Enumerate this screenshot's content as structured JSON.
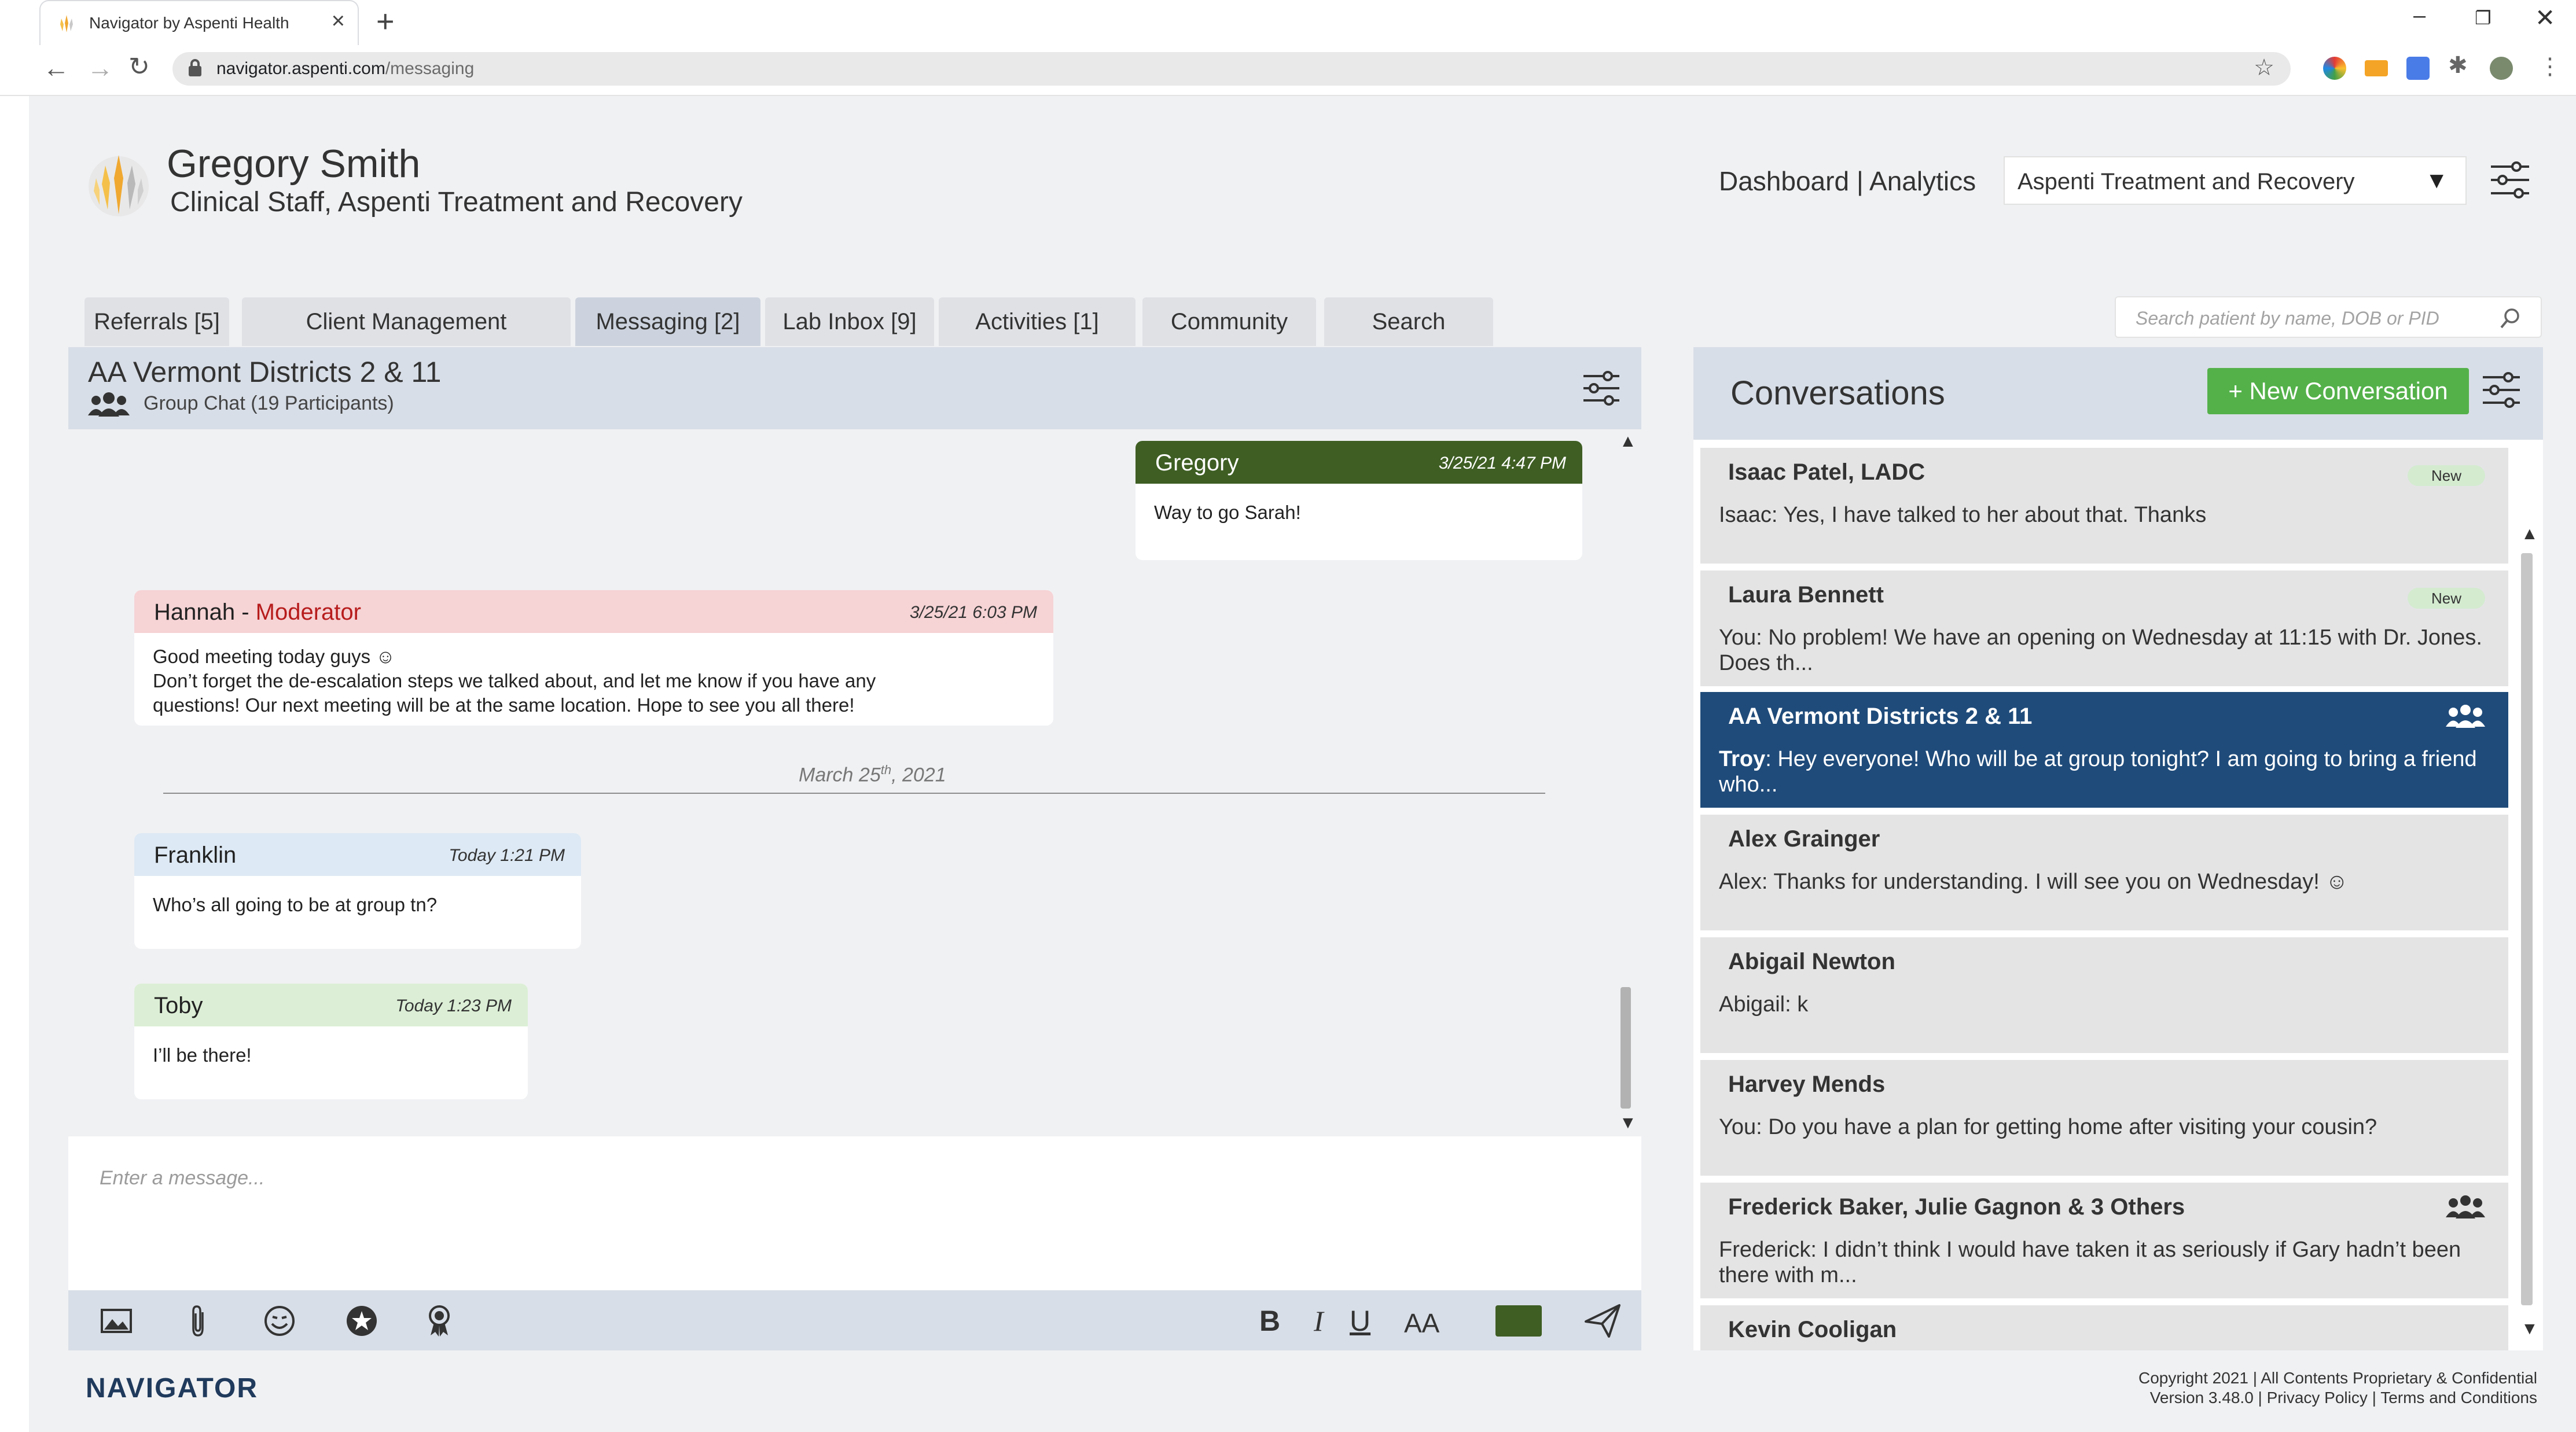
{
  "browser": {
    "tab_title": "Navigator by Aspenti Health",
    "url_host": "navigator.aspenti.com",
    "url_path": "/messaging"
  },
  "header": {
    "user_name": "Gregory Smith",
    "user_role": "Clinical Staff, Aspenti Treatment and Recovery",
    "dashboard_link": "Dashboard | Analytics",
    "org_selected": "Aspenti Treatment and Recovery"
  },
  "tabs": [
    {
      "label": "Referrals [5]"
    },
    {
      "label": "Client Management"
    },
    {
      "label": "Messaging [2]"
    },
    {
      "label": "Lab Inbox [9]"
    },
    {
      "label": "Activities [1]"
    },
    {
      "label": "Community"
    },
    {
      "label": "Search"
    }
  ],
  "search": {
    "placeholder": "Search patient by name, DOB or PID"
  },
  "chat": {
    "title": "AA Vermont Districts 2 & 11",
    "subtitle": "Group Chat (19 Participants)",
    "messages": [
      {
        "sender": "Gregory",
        "time": "3/25/21  4:47 PM",
        "text": "Way to go Sarah!"
      },
      {
        "sender": "Hannah",
        "role_sep": " - ",
        "role": "Moderator",
        "time": "3/25/21   6:03 PM",
        "lines": [
          "Good meeting today guys ☺",
          "Don’t forget the de-escalation steps we talked about, and let me know if you have any",
          "questions! Our next meeting will be at the same location. Hope to see you all there!"
        ]
      },
      {
        "sender": "Franklin",
        "time": "Today 1:21 PM",
        "text": "Who’s all going to be at group tn?"
      },
      {
        "sender": "Toby",
        "time": "Today 1:23 PM",
        "text": "I’ll be there!"
      }
    ],
    "date_divider": {
      "main": "March 25",
      "sup": "th",
      "year": ", 2021"
    },
    "composer_placeholder": "Enter a message...",
    "format": {
      "bold": "B",
      "italic": "I",
      "underline": "U",
      "size": "AA"
    }
  },
  "conversations": {
    "title": "Conversations",
    "new_button": "+ New Conversation",
    "items": [
      {
        "name": "Isaac Patel, LADC",
        "preview": "Isaac: Yes, I have talked to her about that. Thanks",
        "badge": "New"
      },
      {
        "name": "Laura Bennett",
        "preview": "You: No problem! We have an opening on Wednesday at 11:15 with Dr. Jones. Does th...",
        "badge": "New"
      },
      {
        "name": "AA Vermont Districts 2 & 11",
        "preview_who": "Troy",
        "preview_rest": ": Hey everyone! Who will be at group tonight? I am going to bring a friend who...",
        "group": true
      },
      {
        "name": "Alex Grainger",
        "preview": "Alex: Thanks for understanding. I will see you on Wednesday! ☺"
      },
      {
        "name": "Abigail Newton",
        "preview": "Abigail: k"
      },
      {
        "name": "Harvey Mends",
        "preview": "You: Do you have a plan for getting home after visiting your cousin?"
      },
      {
        "name": "Frederick Baker, Julie Gagnon & 3 Others",
        "preview": "Frederick: I didn’t think I would have taken it as seriously if Gary hadn’t been there with m...",
        "group": true
      },
      {
        "name": "Kevin Cooligan",
        "preview": ""
      }
    ]
  },
  "footer": {
    "brand": "NAVIGATOR",
    "line1": "Copyright 2021 | All Contents Proprietary & Confidential",
    "line2": "Version 3.48.0 | Privacy Policy | Terms and Conditions"
  },
  "colors": {
    "accent_green": "#54b14a",
    "selected_blue": "#1f4b7a",
    "gregory_header": "#3e5e23",
    "moderator_red": "#b71c1c"
  }
}
